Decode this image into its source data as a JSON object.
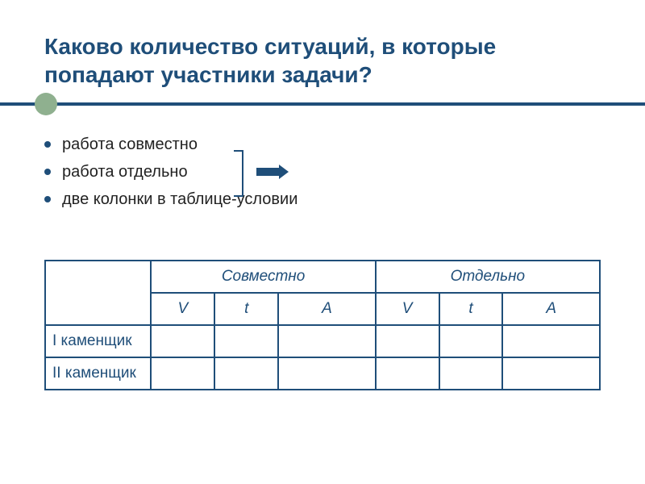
{
  "title": "Каково количество ситуаций, в которые попадают участники задачи?",
  "bullets": {
    "b0": "работа совместно",
    "b1": "работа отдельно",
    "b2": "две колонки в таблице-условии"
  },
  "table": {
    "group1": "Совместно",
    "group2": "Отдельно",
    "col_v": "V",
    "col_t": "t",
    "col_a": "A",
    "row1": "I каменщик",
    "row2": "II каменщик"
  }
}
